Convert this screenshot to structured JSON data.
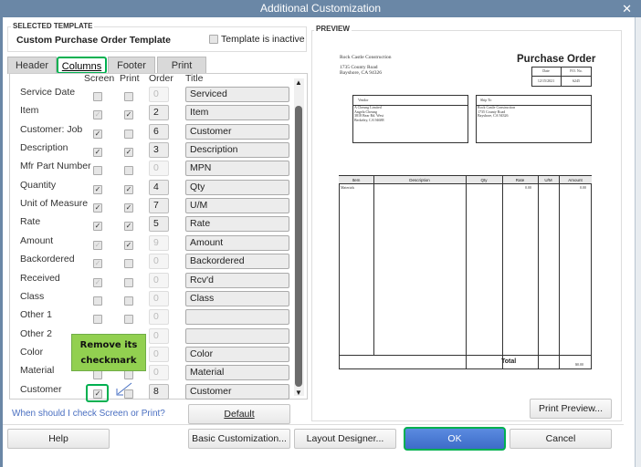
{
  "window": {
    "title": "Additional Customization",
    "close_icon": "close-icon"
  },
  "template": {
    "group_label": "SELECTED TEMPLATE",
    "name": "Custom Purchase Order Template",
    "inactive_label": "Template is inactive",
    "inactive_checked": false
  },
  "tabs": [
    {
      "label": "Header"
    },
    {
      "label": "Columns",
      "active": true
    },
    {
      "label": "Footer"
    },
    {
      "label": "Print"
    }
  ],
  "columns": {
    "headers": {
      "screen": "Screen",
      "print": "Print",
      "order": "Order",
      "title": "Title"
    },
    "rows": [
      {
        "label": "Service Date",
        "screen": "unchecked",
        "print": "unchecked",
        "order": "0",
        "order_disabled": true,
        "title": "Serviced"
      },
      {
        "label": "Item",
        "screen": "disabled-checked",
        "print": "checked",
        "order": "2",
        "order_disabled": false,
        "title": "Item"
      },
      {
        "label": "Customer: Job",
        "screen": "checked",
        "print": "unchecked",
        "order": "6",
        "order_disabled": false,
        "title": "Customer"
      },
      {
        "label": "Description",
        "screen": "checked",
        "print": "checked",
        "order": "3",
        "order_disabled": false,
        "title": "Description"
      },
      {
        "label": "Mfr Part Number",
        "screen": "unchecked",
        "print": "unchecked",
        "order": "0",
        "order_disabled": true,
        "title": "MPN"
      },
      {
        "label": "Quantity",
        "screen": "checked",
        "print": "checked",
        "order": "4",
        "order_disabled": false,
        "title": "Qty"
      },
      {
        "label": "Unit of Measure",
        "screen": "checked",
        "print": "checked",
        "order": "7",
        "order_disabled": false,
        "title": "U/M"
      },
      {
        "label": "Rate",
        "screen": "checked",
        "print": "checked",
        "order": "5",
        "order_disabled": false,
        "title": "Rate"
      },
      {
        "label": "Amount",
        "screen": "disabled-checked",
        "print": "checked",
        "order": "9",
        "order_disabled": true,
        "title": "Amount"
      },
      {
        "label": "Backordered",
        "screen": "disabled-checked",
        "print": "unchecked",
        "order": "0",
        "order_disabled": true,
        "title": "Backordered"
      },
      {
        "label": "Received",
        "screen": "disabled-checked",
        "print": "unchecked",
        "order": "0",
        "order_disabled": true,
        "title": "Rcv'd"
      },
      {
        "label": "Class",
        "screen": "unchecked",
        "print": "unchecked",
        "order": "0",
        "order_disabled": true,
        "title": "Class"
      },
      {
        "label": "Other 1",
        "screen": "unchecked",
        "print": "unchecked",
        "order": "0",
        "order_disabled": true,
        "title": ""
      },
      {
        "label": "Other 2",
        "screen": "unchecked",
        "print": "unchecked",
        "order": "0",
        "order_disabled": true,
        "title": ""
      },
      {
        "label": "Color",
        "screen": "unchecked",
        "print": "unchecked",
        "order": "0",
        "order_disabled": true,
        "title": "Color"
      },
      {
        "label": "Material",
        "screen": "unchecked",
        "print": "unchecked",
        "order": "0",
        "order_disabled": true,
        "title": "Material"
      },
      {
        "label": "Customer",
        "screen": "checked",
        "print": "unchecked",
        "order": "8",
        "order_disabled": false,
        "title": "Customer"
      }
    ]
  },
  "help_link": "When should I check Screen or Print?",
  "default_button": "Default",
  "callout": {
    "text": "Remove its checkmark",
    "color": "#92d050"
  },
  "highlight_color": "#00b050",
  "preview": {
    "label": "PREVIEW",
    "company": "Rock Castle Construction",
    "address1": "1735 County Road",
    "address2": "Bayshore, CA 94326",
    "doc_title": "Purchase Order",
    "date_label": "Date",
    "po_label": "P.O. No.",
    "date": "12/15/2021",
    "po": "6245",
    "vendor_label": "Vendor",
    "vendor_lines": [
      "A Cheung Limited",
      "Angela Cheung",
      "3818 Bear Rd. West",
      "Berkeley, CA 94688"
    ],
    "shipto_label": "Ship To",
    "shipto_lines": [
      "Rock Castle Construction",
      "1735 County Road",
      "Bayshore, CA 94326"
    ],
    "table_headers": [
      "Item",
      "Description",
      "Qty",
      "Rate",
      "U/M",
      "Amount"
    ],
    "row": {
      "item": "Materials",
      "rate": "0.00",
      "amount": "0.00"
    },
    "total_label": "Total",
    "total": "$0.00"
  },
  "print_preview_button": "Print Preview...",
  "footer": {
    "help": "Help",
    "basic": "Basic Customization...",
    "layout": "Layout Designer...",
    "ok": "OK",
    "cancel": "Cancel"
  }
}
